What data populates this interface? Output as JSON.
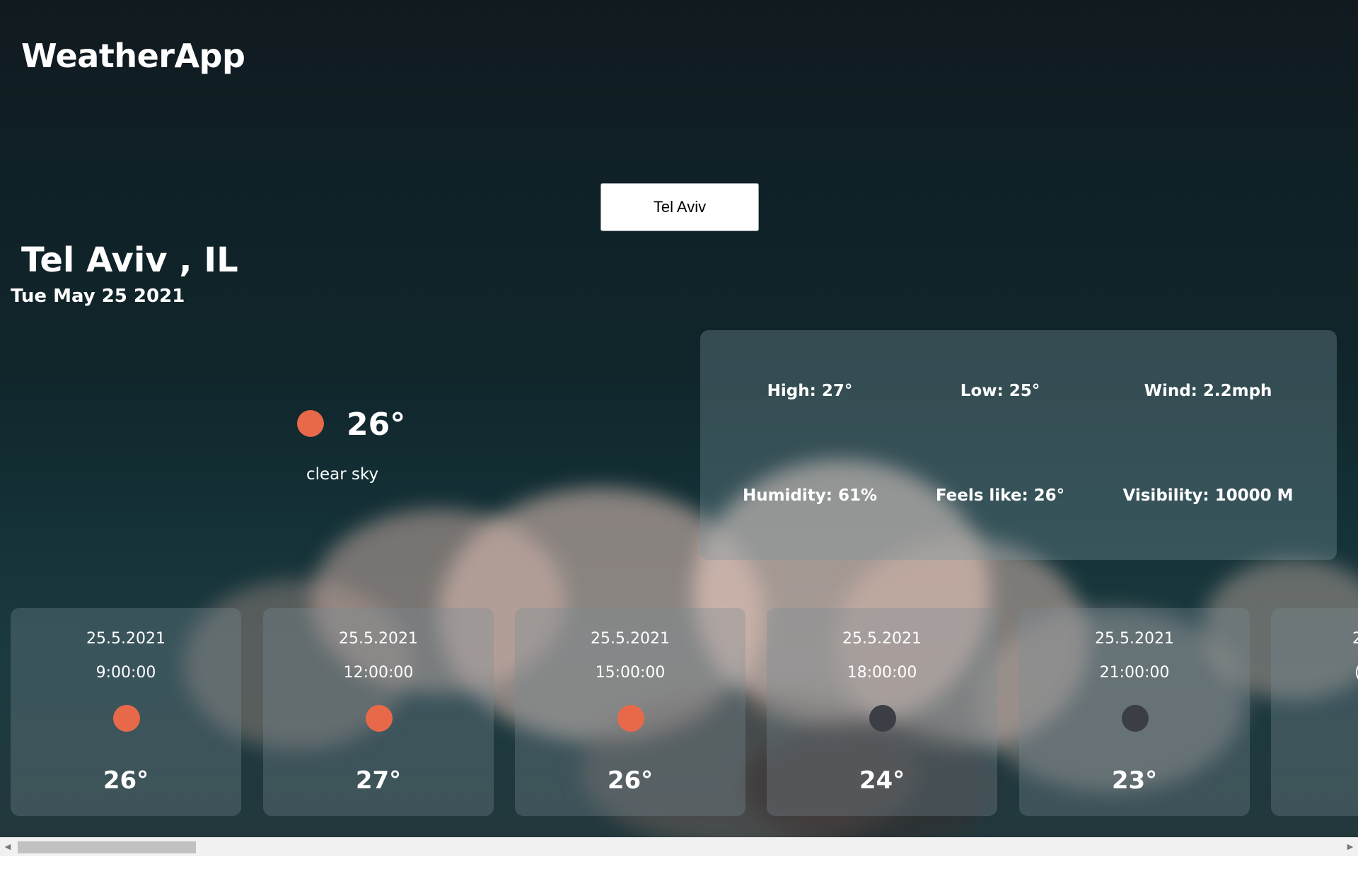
{
  "app": {
    "title": "WeatherApp"
  },
  "search": {
    "value": "Tel Aviv"
  },
  "location": {
    "city": "Tel Aviv , IL",
    "date": "Tue May 25 2021"
  },
  "current": {
    "temp": "26°",
    "description": "clear sky",
    "icon": "sun-icon",
    "icon_color": "#e8694a"
  },
  "details": {
    "high": "High: 27°",
    "low": "Low: 25°",
    "wind": "Wind: 2.2mph",
    "humidity": "Humidity: 61%",
    "feels_like": "Feels like: 26°",
    "visibility": "Visibility: 10000 M"
  },
  "forecast": [
    {
      "date": "25.5.2021",
      "time": "9:00:00",
      "icon": "sun-icon",
      "temp": "26°"
    },
    {
      "date": "25.5.2021",
      "time": "12:00:00",
      "icon": "sun-icon",
      "temp": "27°"
    },
    {
      "date": "25.5.2021",
      "time": "15:00:00",
      "icon": "sun-icon",
      "temp": "26°"
    },
    {
      "date": "25.5.2021",
      "time": "18:00:00",
      "icon": "moon-icon",
      "temp": "24°"
    },
    {
      "date": "25.5.2021",
      "time": "21:00:00",
      "icon": "moon-icon",
      "temp": "23°"
    }
  ],
  "forecast_partial": {
    "date_fragment": "2",
    "time_fragment": "("
  },
  "scrollbar": {
    "left_arrow": "◀",
    "right_arrow": "▶"
  },
  "colors": {
    "sun": "#e8694a",
    "moon": "#3b3e44"
  }
}
